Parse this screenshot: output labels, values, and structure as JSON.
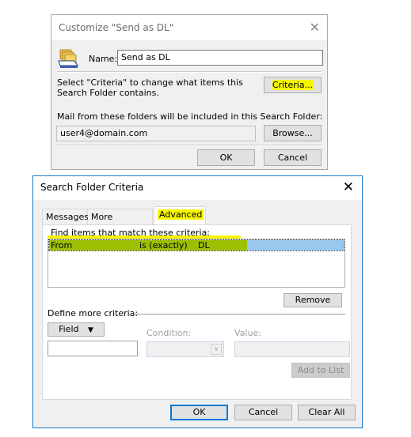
{
  "customize_dialog": {
    "title": "Customize \"Send as DL\"",
    "close_icon": "close-icon",
    "folder_icon": "search-folder-icon",
    "name_label": "Name:",
    "name_value": "Send as DL",
    "criteria_hint": "Select \"Criteria\" to change what items this Search Folder contains.",
    "criteria_hint_line1": "Select \"Criteria\" to change what items this",
    "criteria_hint_line2": "Search Folder contains.",
    "criteria_button": "Criteria...",
    "folders_label": "Mail from these folders will be included in this Search Folder:",
    "folders_value": "user4@domain.com",
    "browse_button": "Browse...",
    "ok_button": "OK",
    "cancel_button": "Cancel"
  },
  "criteria_dialog": {
    "title": "Search Folder Criteria",
    "close_icon": "close-icon",
    "tabs": [
      {
        "label": "Messages",
        "active": false
      },
      {
        "label": "More Choices",
        "active": false
      },
      {
        "label": "Advanced",
        "active": true
      }
    ],
    "find_label": "Find items that match these criteria:",
    "criteria_rows": [
      {
        "field": "From",
        "condition": "is (exactly)",
        "value": "DL",
        "selected": true
      }
    ],
    "remove_button": "Remove",
    "define_more_label": "Define more criteria:",
    "field_button": "Field",
    "field_value": "",
    "condition_label": "Condition:",
    "condition_value": "",
    "value_label": "Value:",
    "value_value": "",
    "add_to_list_button": "Add to List",
    "ok_button": "OK",
    "cancel_button": "Cancel",
    "clear_all_button": "Clear All"
  },
  "colors": {
    "highlight": "#f5f500",
    "selection": "#99c9ef",
    "focus_border": "#0078d7"
  }
}
